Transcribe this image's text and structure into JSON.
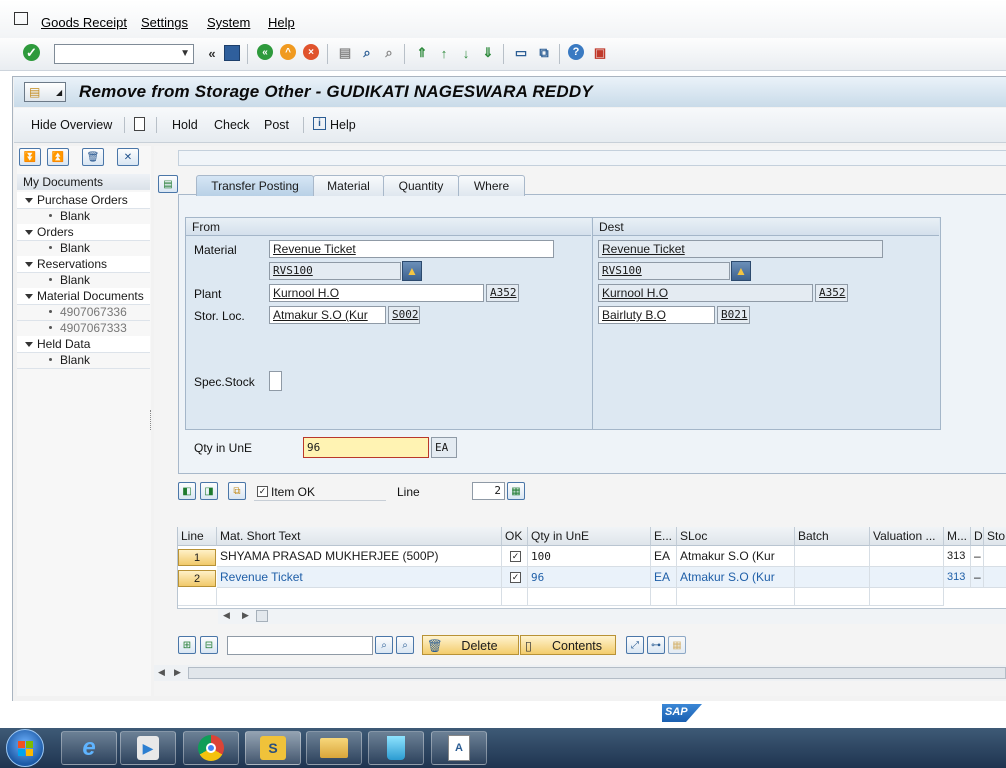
{
  "menu": [
    "Goods Receipt",
    "Settings",
    "System",
    "Help"
  ],
  "toolbar_icons": [
    "enter-icon",
    "back-icon",
    "save-icon",
    "exit-icon",
    "cancel-icon",
    "print-icon",
    "find-icon",
    "find-next-icon",
    "first-page-icon",
    "prev-page-icon",
    "next-page-icon",
    "last-page-icon",
    "new-session-icon",
    "shortcut-icon",
    "help-icon",
    "layout-icon"
  ],
  "title": "Remove from Storage Other - GUDIKATI NAGESWARA REDDY",
  "appbar": {
    "hide_overview": "Hide Overview",
    "hold": "Hold",
    "check": "Check",
    "post": "Post",
    "help": "Help"
  },
  "nav": {
    "header": "My Documents",
    "groups": [
      {
        "label": "Purchase Orders",
        "items": [
          "Blank"
        ]
      },
      {
        "label": "Orders",
        "items": [
          "Blank"
        ]
      },
      {
        "label": "Reservations",
        "items": [
          "Blank"
        ]
      },
      {
        "label": "Material Documents",
        "items": [
          "4907067336",
          "4907067333"
        ]
      },
      {
        "label": "Held Data",
        "items": [
          "Blank"
        ]
      }
    ]
  },
  "tabs": [
    "Transfer Posting",
    "Material",
    "Quantity",
    "Where"
  ],
  "from": {
    "header": "From",
    "material_label": "Material",
    "material": "Revenue Ticket",
    "material_code": "RVS100",
    "plant_label": "Plant",
    "plant": "Kurnool H.O",
    "plant_code": "A352",
    "sloc_label": "Stor. Loc.",
    "sloc": "Atmakur S.O (Kur",
    "sloc_code": "S002",
    "spec_stock_label": "Spec.Stock"
  },
  "dest": {
    "header": "Dest",
    "material": "Revenue Ticket",
    "material_code": "RVS100",
    "plant": "Kurnool H.O",
    "plant_code": "A352",
    "sloc": "Bairluty B.O",
    "sloc_code": "B021"
  },
  "qty": {
    "label": "Qty in UnE",
    "value": "96",
    "unit": "EA"
  },
  "item_ok": {
    "label": "Item OK",
    "line_label": "Line",
    "line": "2"
  },
  "table": {
    "columns": [
      "Line",
      "Mat. Short Text",
      "OK",
      "Qty in UnE",
      "E...",
      "SLoc",
      "Batch",
      "Valuation ...",
      "M...",
      "D",
      "Sto"
    ],
    "rows": [
      {
        "line": "1",
        "text": "SHYAMA PRASAD MUKHERJEE (500P)",
        "ok": "✓",
        "qty": "100",
        "unit": "EA",
        "sloc": "Atmakur S.O (Kur",
        "batch": "",
        "valuation": "",
        "mvt": "313",
        "d": "–"
      },
      {
        "line": "2",
        "text": "Revenue Ticket",
        "ok": "✓",
        "qty": "96",
        "unit": "EA",
        "sloc": "Atmakur S.O (Kur",
        "batch": "",
        "valuation": "",
        "mvt": "313",
        "d": "–"
      }
    ]
  },
  "bottom": {
    "delete": "Delete",
    "contents": "Contents"
  },
  "sap_logo": "SAP",
  "colors": {
    "highlight_row_text": "#1f5fa8",
    "qty_field_bg": "#fff3b3",
    "accent_button": "#f3cc6c"
  }
}
